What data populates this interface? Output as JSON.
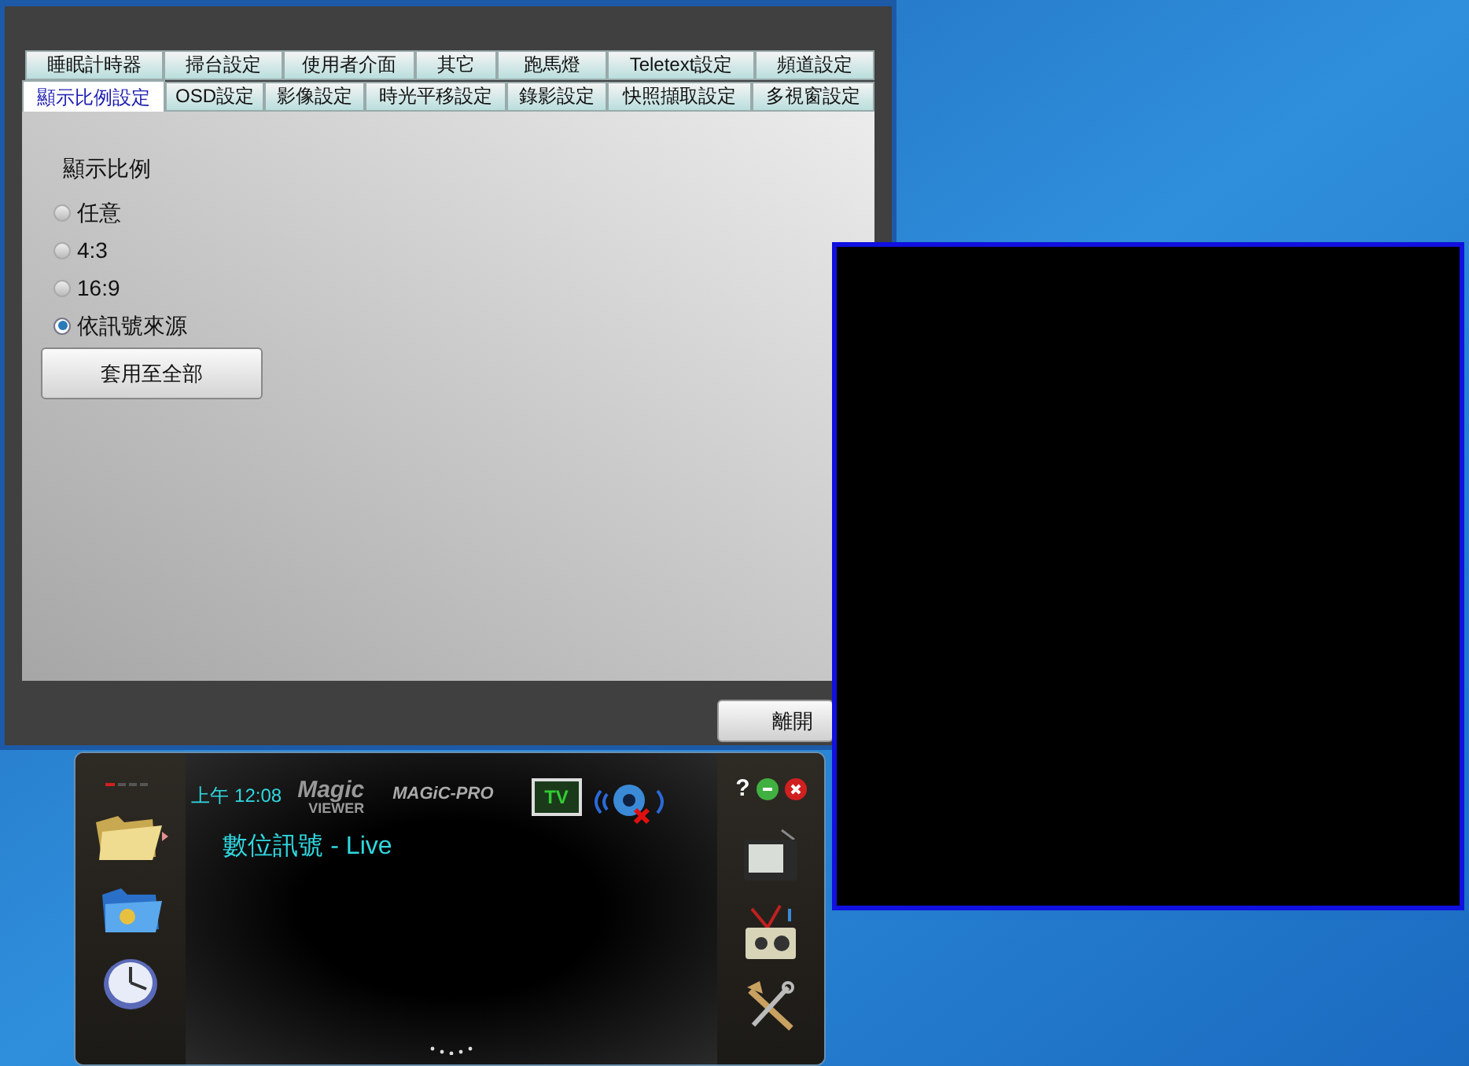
{
  "settings_dialog": {
    "tabs_row_1": [
      {
        "label": "睡眠計時器",
        "selected": false
      },
      {
        "label": "掃台設定",
        "selected": false
      },
      {
        "label": "使用者介面",
        "selected": false
      },
      {
        "label": "其它",
        "selected": false
      },
      {
        "label": "跑馬燈",
        "selected": false
      },
      {
        "label": "Teletext設定",
        "selected": false
      },
      {
        "label": "頻道設定",
        "selected": false
      }
    ],
    "tabs_row_2": [
      {
        "label": "顯示比例設定",
        "selected": true
      },
      {
        "label": "OSD設定",
        "selected": false
      },
      {
        "label": "影像設定",
        "selected": false
      },
      {
        "label": "時光平移設定",
        "selected": false
      },
      {
        "label": "錄影設定",
        "selected": false
      },
      {
        "label": "快照擷取設定",
        "selected": false
      },
      {
        "label": "多視窗設定",
        "selected": false
      }
    ],
    "section_title": "顯示比例",
    "radios": [
      {
        "label": "任意",
        "selected": false
      },
      {
        "label": "4:3",
        "selected": false
      },
      {
        "label": "16:9",
        "selected": false
      },
      {
        "label": "依訊號來源",
        "selected": true
      }
    ],
    "apply_button": "套用至全部",
    "close_button": "離開"
  },
  "player": {
    "time": "上午 12:08",
    "logo_1": "Magic",
    "logo_1_sub": "VIEWER",
    "logo_2": "MAGiC-PRO",
    "tv_badge": "TV",
    "help": "?",
    "channel": "數位訊號 - Live"
  }
}
